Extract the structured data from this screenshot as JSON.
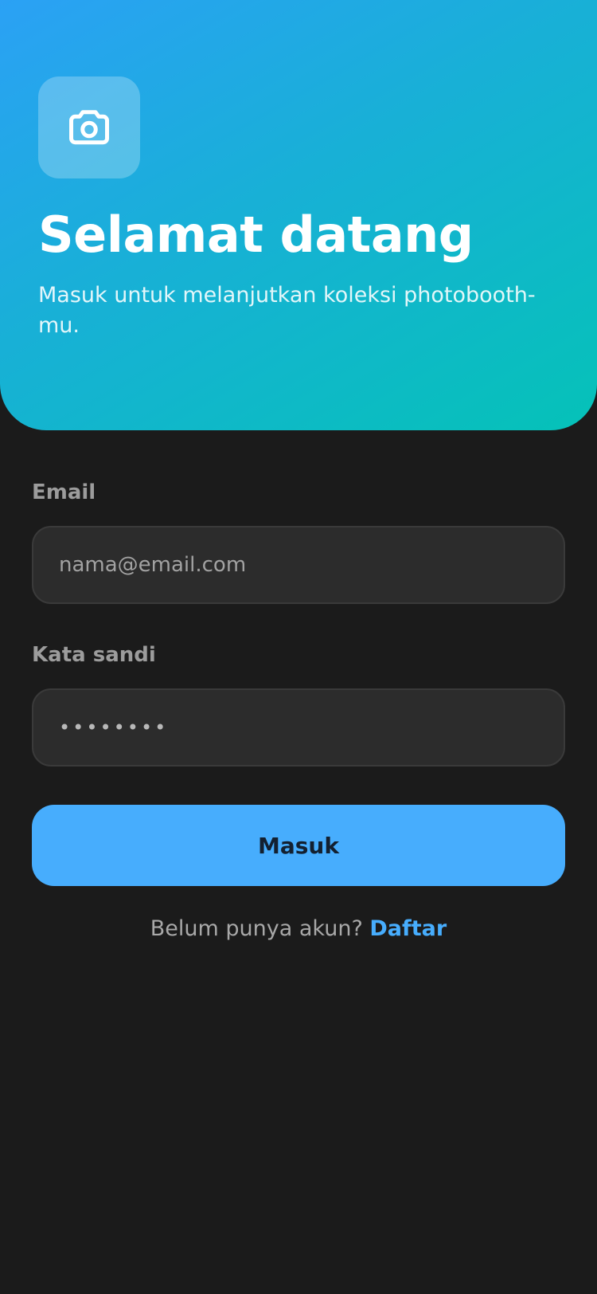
{
  "hero": {
    "icon": "camera-icon",
    "title": "Selamat datang",
    "subtitle": "Masuk untuk melanjutkan koleksi photobooth-mu."
  },
  "form": {
    "email": {
      "label": "Email",
      "value": "",
      "placeholder": "nama@email.com"
    },
    "password": {
      "label": "Kata sandi",
      "value": "••••••••",
      "placeholder": ""
    },
    "submit_label": "Masuk"
  },
  "signup": {
    "prompt": "Belum punya akun? ",
    "link_label": "Daftar"
  },
  "colors": {
    "background": "#1b1b1b",
    "hero_gradient_start": "#2ba1f5",
    "hero_gradient_end": "#05c2b8",
    "accent": "#47adfd",
    "input_background": "#2c2c2c",
    "label": "#9c9c9c"
  }
}
